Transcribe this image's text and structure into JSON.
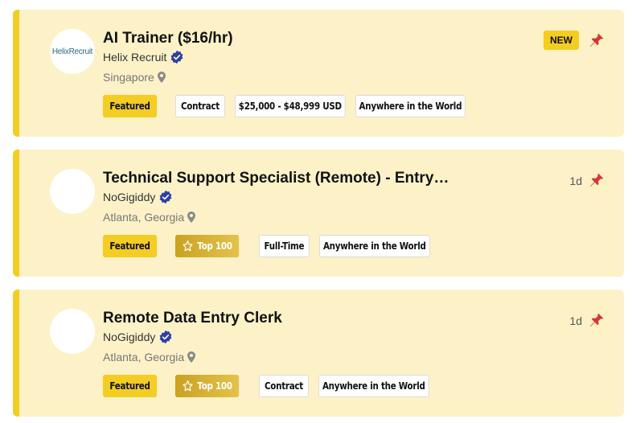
{
  "jobs": [
    {
      "title": "AI Trainer ($16/hr)",
      "company": "Helix Recruit",
      "logo_text": "HelixRecruit",
      "location": "Singapore",
      "badge": "NEW",
      "age": "",
      "tags": [
        "Featured",
        "Contract",
        "$25,000 - $48,999 USD",
        "Anywhere in the World"
      ]
    },
    {
      "title": "Technical Support Specialist (Remote) - Entry…",
      "company": "NoGigiddy",
      "logo_text": "",
      "location": "Atlanta, Georgia",
      "badge": "",
      "age": "1d",
      "tags": [
        "Featured",
        "Top 100",
        "Full-Time",
        "Anywhere in the World"
      ]
    },
    {
      "title": "Remote Data Entry Clerk",
      "company": "NoGigiddy",
      "logo_text": "",
      "location": "Atlanta, Georgia",
      "badge": "",
      "age": "1d",
      "tags": [
        "Featured",
        "Top 100",
        "Contract",
        "Anywhere in the World"
      ]
    }
  ],
  "icons": {
    "verified": "verified-badge-icon",
    "location": "location-pin-icon",
    "pin": "pushpin-icon",
    "star": "star-outline-icon"
  },
  "colors": {
    "card_bg": "#fdf1c8",
    "accent": "#f3cd23",
    "top100_gold": "#c9a223",
    "verified_blue": "#2e3ea6",
    "pin_red": "#d6343a"
  }
}
